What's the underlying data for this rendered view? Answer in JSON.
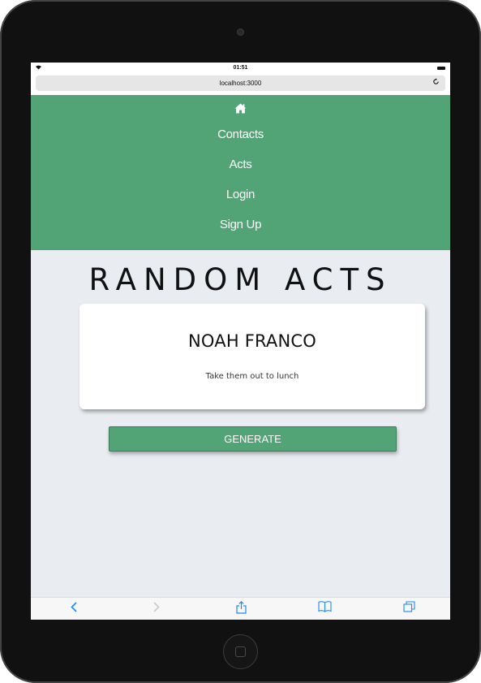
{
  "status_bar": {
    "time": "01:51"
  },
  "browser": {
    "url": "localhost:3000"
  },
  "navbar": {
    "links": [
      {
        "label": "Contacts"
      },
      {
        "label": "Acts"
      },
      {
        "label": "Login"
      },
      {
        "label": "Sign Up"
      }
    ]
  },
  "main": {
    "title": "RANDOM ACTS",
    "card": {
      "name": "NOAH FRANCO",
      "act": "Take them out to lunch"
    },
    "generate_label": "GENERATE"
  },
  "colors": {
    "navbar_bg": "#52a375",
    "page_bg": "#e9edf1",
    "button_bg": "#52a375",
    "toolbar_accent": "#1e88ff"
  },
  "icons": {
    "home": "home-icon",
    "back": "chevron-left-icon",
    "forward": "chevron-right-icon",
    "share": "share-icon",
    "bookmarks": "book-icon",
    "tabs": "tabs-icon"
  }
}
